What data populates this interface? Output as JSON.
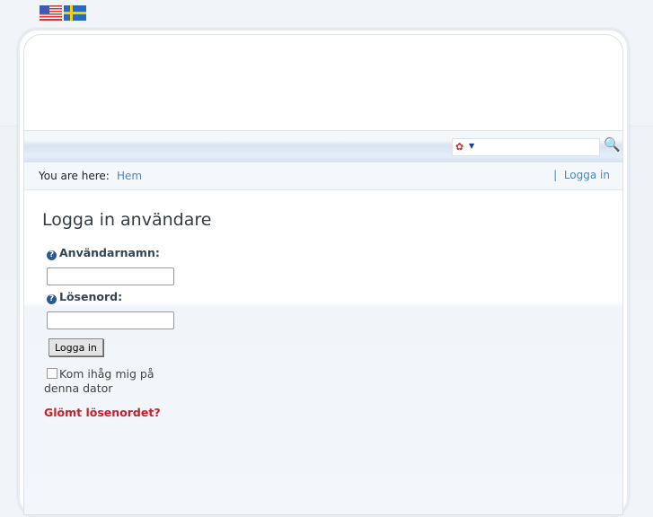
{
  "flags": [
    {
      "name": "us-flag-icon",
      "label": "English"
    },
    {
      "name": "se-flag-icon",
      "label": "Svenska"
    }
  ],
  "breadcrumb": {
    "label": "You are here:",
    "home": "Hem",
    "login_link": "Logga in",
    "separator": "|"
  },
  "login": {
    "title": "Logga in användare",
    "username_label": "Användarnamn:",
    "username_value": "",
    "password_label": "Lösenord:",
    "password_value": "",
    "submit": "Logga in",
    "remember": "Kom ihåg mig på denna dator",
    "forgot": "Glömt lösenordet?"
  },
  "search": {
    "value": ""
  }
}
